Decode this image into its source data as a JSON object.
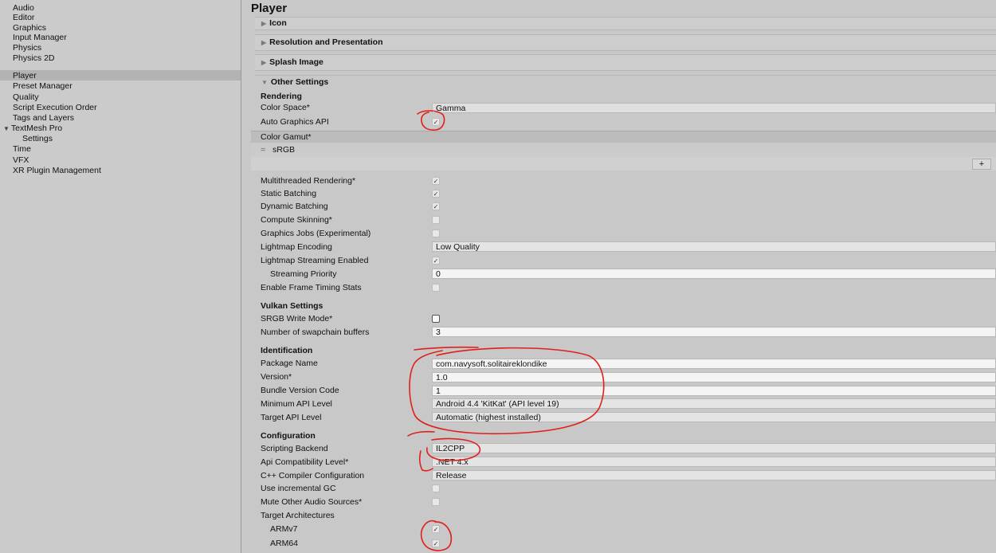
{
  "sidebar": {
    "items": [
      {
        "label": "Audio"
      },
      {
        "label": "Editor"
      },
      {
        "label": "Graphics"
      },
      {
        "label": "Input Manager"
      },
      {
        "label": "Physics"
      },
      {
        "label": "Physics 2D"
      },
      {
        "label": "Player"
      },
      {
        "label": "Preset Manager"
      },
      {
        "label": "Quality"
      },
      {
        "label": "Script Execution Order"
      },
      {
        "label": "Tags and Layers"
      },
      {
        "label": "TextMesh Pro"
      },
      {
        "label": "Settings"
      },
      {
        "label": "Time"
      },
      {
        "label": "VFX"
      },
      {
        "label": "XR Plugin Management"
      }
    ],
    "selected": "Player"
  },
  "main": {
    "title": "Player",
    "foldouts": {
      "icon": "Icon",
      "resolution": "Resolution and Presentation",
      "splash": "Splash Image",
      "other": "Other Settings"
    },
    "rendering": {
      "title": "Rendering",
      "color_space_label": "Color Space*",
      "color_space_value": "Gamma",
      "auto_graphics_api_label": "Auto Graphics API",
      "color_gamut_label": "Color Gamut*",
      "color_gamut_item": "sRGB",
      "add_symbol": "+",
      "multithreaded_label": "Multithreaded Rendering*",
      "static_batching_label": "Static Batching",
      "dynamic_batching_label": "Dynamic Batching",
      "compute_skinning_label": "Compute Skinning*",
      "graphics_jobs_label": "Graphics Jobs (Experimental)",
      "lightmap_encoding_label": "Lightmap Encoding",
      "lightmap_encoding_value": "Low Quality",
      "lightmap_streaming_label": "Lightmap Streaming Enabled",
      "streaming_priority_label": "Streaming Priority",
      "streaming_priority_value": "0",
      "frame_timing_label": "Enable Frame Timing Stats"
    },
    "vulkan": {
      "title": "Vulkan Settings",
      "srgb_write_label": "SRGB Write Mode*",
      "swapchain_label": "Number of swapchain buffers",
      "swapchain_value": "3"
    },
    "identification": {
      "title": "Identification",
      "package_name_label": "Package Name",
      "package_name_value": "com.navysoft.solitaireklondike",
      "version_label": "Version*",
      "version_value": "1.0",
      "bundle_code_label": "Bundle Version Code",
      "bundle_code_value": "1",
      "min_api_label": "Minimum API Level",
      "min_api_value": "Android 4.4 'KitKat' (API level 19)",
      "target_api_label": "Target API Level",
      "target_api_value": "Automatic (highest installed)"
    },
    "configuration": {
      "title": "Configuration",
      "scripting_backend_label": "Scripting Backend",
      "scripting_backend_value": "IL2CPP",
      "api_compat_label": "Api Compatibility Level*",
      "api_compat_value": ".NET 4.x",
      "cpp_compiler_label": "C++ Compiler Configuration",
      "cpp_compiler_value": "Release",
      "incremental_gc_label": "Use incremental GC",
      "mute_audio_label": "Mute Other Audio Sources*",
      "target_arch_label": "Target Architectures",
      "armv7_label": "ARMv7",
      "arm64_label": "ARM64"
    }
  },
  "annotation_color": "#e0201b",
  "checkmark": "✓"
}
